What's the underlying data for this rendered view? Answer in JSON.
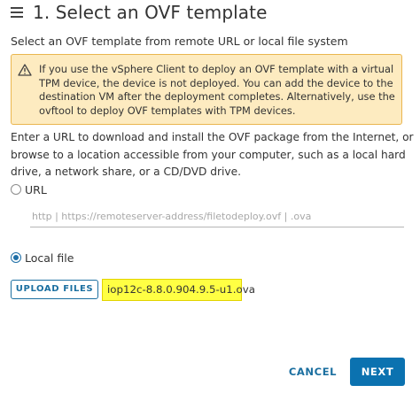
{
  "header": {
    "title": "1. Select an OVF template",
    "menu_icon": "hamburger-menu-icon"
  },
  "subtitle": "Select an OVF template from remote URL or local file system",
  "warning": {
    "icon": "warning-triangle-icon",
    "text": "If you use the vSphere Client to deploy an OVF template with a virtual TPM device, the device is not deployed. You can add the device to the destination VM after the deployment completes. Alternatively, use the ovftool to deploy OVF templates with TPM devices.",
    "background": "#fdebc0",
    "border": "#eab64f"
  },
  "description": "Enter a URL to download and install the OVF package from the Internet, or browse to a location accessible from your computer, such as a local hard drive, a network share, or a CD/DVD drive.",
  "source_options": {
    "url_label": "URL",
    "url_selected": false,
    "url_placeholder": "http | https://remoteserver-address/filetodeploy.ovf | .ova",
    "url_value": "",
    "local_label": "Local file",
    "local_selected": true
  },
  "upload": {
    "button_label": "UPLOAD FILES",
    "selected_file": "iop12c-8.8.0.904.9.5-u1.ova",
    "highlight_color": "#ffff43"
  },
  "footer": {
    "cancel_label": "CANCEL",
    "next_label": "NEXT",
    "accent": "#0b72b0"
  }
}
